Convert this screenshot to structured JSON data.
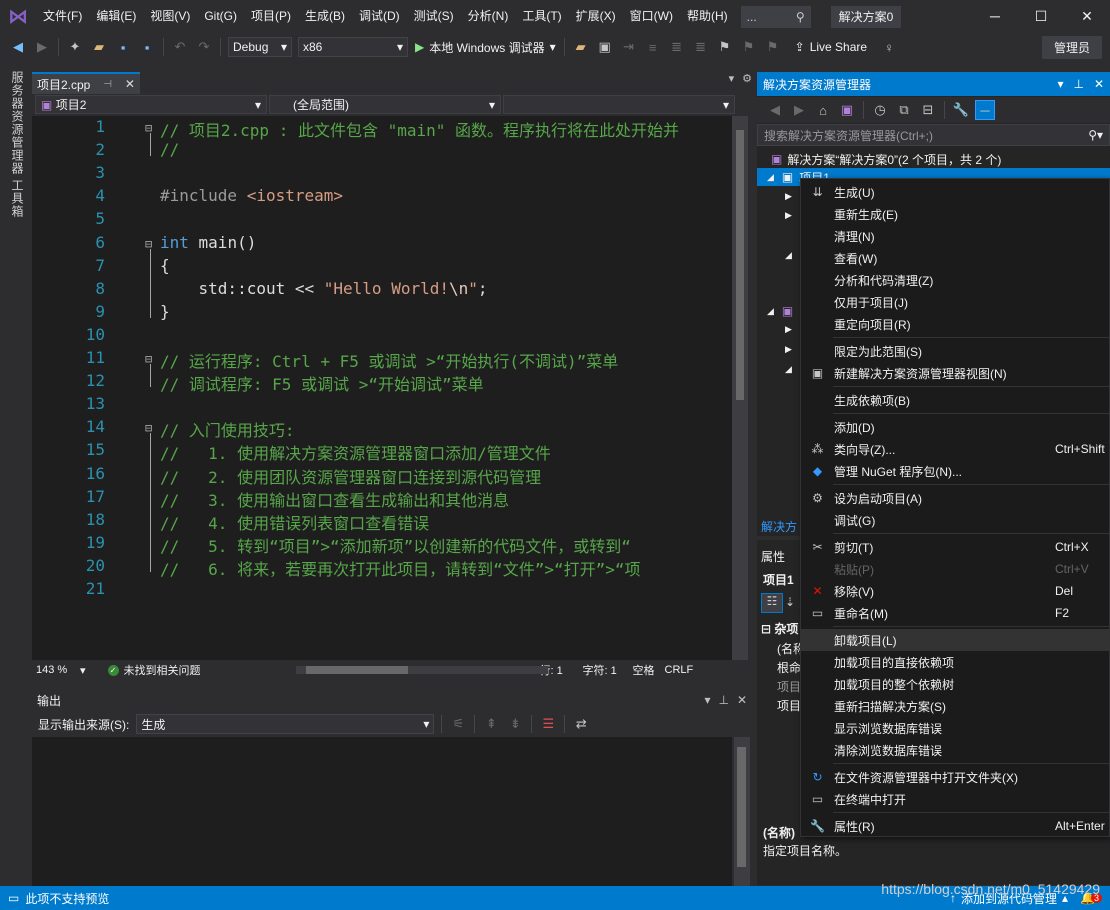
{
  "menubar": {
    "items": [
      "文件(F)",
      "编辑(E)",
      "视图(V)",
      "Git(G)",
      "项目(P)",
      "生成(B)",
      "调试(D)",
      "测试(S)",
      "分析(N)",
      "工具(T)",
      "扩展(X)",
      "窗口(W)",
      "帮助(H)"
    ],
    "search_text": "...",
    "solution_title": "解决方案0"
  },
  "toolbar": {
    "config": "Debug",
    "platform": "x86",
    "run_label": "本地 Windows 调试器",
    "liveshare": "Live Share",
    "admin": "管理员"
  },
  "left_rail": {
    "server_explorer": "服务器资源管理器",
    "toolbox": "工具箱"
  },
  "editor": {
    "tab_label": "项目2.cpp",
    "nav_project": "项目2",
    "nav_scope": "(全局范围)",
    "lines": [
      {
        "n": "1",
        "fold": "⊟",
        "html": [
          [
            "cm",
            "// 项目2.cpp : 此文件包含 \"main\" 函数。程序执行将在此处开始并"
          ]
        ]
      },
      {
        "n": "2",
        "fold": "",
        "html": [
          [
            "cm",
            "//"
          ]
        ]
      },
      {
        "n": "3",
        "fold": "",
        "html": []
      },
      {
        "n": "4",
        "fold": "",
        "html": [
          [
            "pp",
            "#include "
          ],
          [
            "str",
            "<iostream>"
          ]
        ]
      },
      {
        "n": "5",
        "fold": "",
        "html": []
      },
      {
        "n": "6",
        "fold": "⊟",
        "html": [
          [
            "kw",
            "int"
          ],
          [
            "tx",
            " main()"
          ]
        ]
      },
      {
        "n": "7",
        "fold": "",
        "html": [
          [
            "tx",
            "{"
          ]
        ]
      },
      {
        "n": "8",
        "fold": "",
        "html": [
          [
            "tx",
            "    std::cout << "
          ],
          [
            "str",
            "\"Hello World!"
          ],
          [
            "esc",
            "\\n"
          ],
          [
            "str",
            "\""
          ],
          [
            "tx",
            ";"
          ]
        ]
      },
      {
        "n": "9",
        "fold": "",
        "html": [
          [
            "tx",
            "}"
          ]
        ]
      },
      {
        "n": "10",
        "fold": "",
        "html": []
      },
      {
        "n": "11",
        "fold": "⊟",
        "html": [
          [
            "cm",
            "// 运行程序: Ctrl + F5 或调试 >“开始执行(不调试)”菜单"
          ]
        ]
      },
      {
        "n": "12",
        "fold": "",
        "html": [
          [
            "cm",
            "// 调试程序: F5 或调试 >“开始调试”菜单"
          ]
        ]
      },
      {
        "n": "13",
        "fold": "",
        "html": []
      },
      {
        "n": "14",
        "fold": "⊟",
        "html": [
          [
            "cm",
            "// 入门使用技巧:"
          ]
        ]
      },
      {
        "n": "15",
        "fold": "",
        "html": [
          [
            "cm",
            "//   1. 使用解决方案资源管理器窗口添加/管理文件"
          ]
        ]
      },
      {
        "n": "16",
        "fold": "",
        "html": [
          [
            "cm",
            "//   2. 使用团队资源管理器窗口连接到源代码管理"
          ]
        ]
      },
      {
        "n": "17",
        "fold": "",
        "html": [
          [
            "cm",
            "//   3. 使用输出窗口查看生成输出和其他消息"
          ]
        ]
      },
      {
        "n": "18",
        "fold": "",
        "html": [
          [
            "cm",
            "//   4. 使用错误列表窗口查看错误"
          ]
        ]
      },
      {
        "n": "19",
        "fold": "",
        "html": [
          [
            "cm",
            "//   5. 转到“项目”>“添加新项”以创建新的代码文件，或转到“"
          ]
        ]
      },
      {
        "n": "20",
        "fold": "",
        "html": [
          [
            "cm",
            "//   6. 将来，若要再次打开此项目，请转到“文件”>“打开”>“项"
          ]
        ]
      },
      {
        "n": "21",
        "fold": "",
        "html": []
      }
    ],
    "zoom": "143 %",
    "issues": "未找到相关问题",
    "row": "行: 1",
    "col": "字符: 1",
    "ws": "空格",
    "eol": "CRLF"
  },
  "output": {
    "title": "输出",
    "source_label": "显示输出来源(S):",
    "source_value": "生成"
  },
  "solution_explorer": {
    "title": "解决方案资源管理器",
    "search_placeholder": "搜索解决方案资源管理器(Ctrl+;)",
    "solution_node": "解决方案“解决方案0”(2 个项目，共 2 个)",
    "project1": "项目1",
    "footer": "解决方"
  },
  "properties": {
    "title": "属性",
    "object": "项目1",
    "category": "杂项",
    "rows": [
      "(名称",
      "根命",
      "项目",
      "项目"
    ],
    "desc_title": "(名称)",
    "desc_text": "指定项目名称。"
  },
  "context_menu": {
    "items": [
      {
        "label": "生成(U)",
        "shortcut": "",
        "icon": "build-icon",
        "glyph": "⇊"
      },
      {
        "label": "重新生成(E)",
        "shortcut": "",
        "icon": "",
        "glyph": ""
      },
      {
        "label": "清理(N)",
        "shortcut": "",
        "icon": "",
        "glyph": ""
      },
      {
        "label": "查看(W)",
        "shortcut": "",
        "icon": "",
        "glyph": ""
      },
      {
        "label": "分析和代码清理(Z)",
        "shortcut": "",
        "icon": "",
        "glyph": ""
      },
      {
        "label": "仅用于项目(J)",
        "shortcut": "",
        "icon": "",
        "glyph": ""
      },
      {
        "label": "重定向项目(R)",
        "shortcut": "",
        "icon": "",
        "glyph": ""
      },
      {
        "sep": true
      },
      {
        "label": "限定为此范围(S)",
        "shortcut": "",
        "icon": "",
        "glyph": ""
      },
      {
        "label": "新建解决方案资源管理器视图(N)",
        "shortcut": "",
        "icon": "new-view-icon",
        "glyph": "▣"
      },
      {
        "sep": true
      },
      {
        "label": "生成依赖项(B)",
        "shortcut": "",
        "icon": "",
        "glyph": ""
      },
      {
        "sep": true
      },
      {
        "label": "添加(D)",
        "shortcut": "",
        "icon": "",
        "glyph": ""
      },
      {
        "label": "类向导(Z)...",
        "shortcut": "Ctrl+Shift",
        "icon": "class-wizard-icon",
        "glyph": "⁂"
      },
      {
        "label": "管理 NuGet 程序包(N)...",
        "shortcut": "",
        "icon": "nuget-icon",
        "glyph": "◆"
      },
      {
        "sep": true
      },
      {
        "label": "设为启动项目(A)",
        "shortcut": "",
        "icon": "gear-icon",
        "glyph": "⚙"
      },
      {
        "label": "调试(G)",
        "shortcut": "",
        "icon": "",
        "glyph": ""
      },
      {
        "sep": true
      },
      {
        "label": "剪切(T)",
        "shortcut": "Ctrl+X",
        "icon": "scissors-icon",
        "glyph": "✂"
      },
      {
        "label": "粘贴(P)",
        "shortcut": "Ctrl+V",
        "icon": "paste-icon",
        "glyph": "",
        "disabled": true
      },
      {
        "label": "移除(V)",
        "shortcut": "Del",
        "icon": "remove-icon",
        "glyph": "✕",
        "danger": true
      },
      {
        "label": "重命名(M)",
        "shortcut": "F2",
        "icon": "rename-icon",
        "glyph": "▭"
      },
      {
        "sep": true
      },
      {
        "label": "卸载项目(L)",
        "shortcut": "",
        "icon": "",
        "glyph": "",
        "hl": true
      },
      {
        "label": "加载项目的直接依赖项",
        "shortcut": "",
        "icon": "",
        "glyph": ""
      },
      {
        "label": "加载项目的整个依赖树",
        "shortcut": "",
        "icon": "",
        "glyph": ""
      },
      {
        "label": "重新扫描解决方案(S)",
        "shortcut": "",
        "icon": "",
        "glyph": ""
      },
      {
        "label": "显示浏览数据库错误",
        "shortcut": "",
        "icon": "",
        "glyph": ""
      },
      {
        "label": "清除浏览数据库错误",
        "shortcut": "",
        "icon": "",
        "glyph": ""
      },
      {
        "sep": true
      },
      {
        "label": "在文件资源管理器中打开文件夹(X)",
        "shortcut": "",
        "icon": "open-folder-icon",
        "glyph": "↻",
        "blue": true
      },
      {
        "label": "在终端中打开",
        "shortcut": "",
        "icon": "terminal-icon",
        "glyph": "▭"
      },
      {
        "sep": true
      },
      {
        "label": "属性(R)",
        "shortcut": "Alt+Enter",
        "icon": "wrench-icon",
        "glyph": "🔧"
      }
    ]
  },
  "statusbar": {
    "left": "此项不支持预览",
    "right": "添加到源代码管理",
    "notif_count": "3"
  },
  "watermark": "https://blog.csdn.net/m0_51429429"
}
